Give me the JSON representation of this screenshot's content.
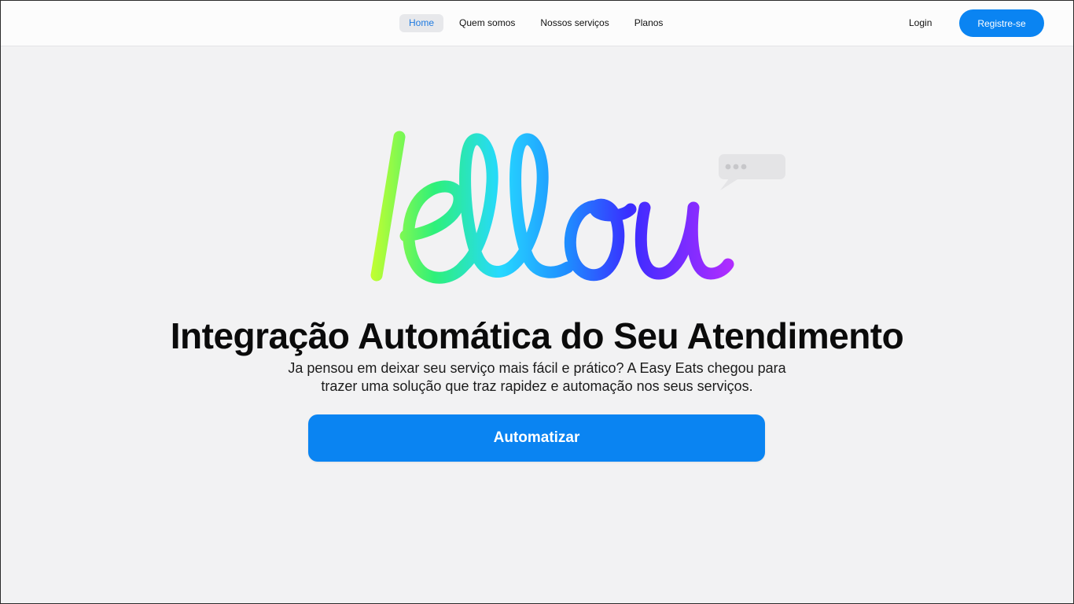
{
  "nav": {
    "items": [
      {
        "label": "Home",
        "active": true
      },
      {
        "label": "Quem somos",
        "active": false
      },
      {
        "label": "Nossos serviços",
        "active": false
      },
      {
        "label": "Planos",
        "active": false
      }
    ],
    "login_label": "Login",
    "register_label": "Registre-se"
  },
  "hero": {
    "logo_text": "lellou",
    "title": "Integração Automática do Seu Atendimento",
    "subtitle_line1": "Ja pensou em deixar seu serviço mais fácil e prático? A Easy Eats chegou para",
    "subtitle_line2": "trazer uma solução que traz rapidez e automação nos seus serviços.",
    "cta_label": "Automatizar"
  },
  "colors": {
    "accent": "#0a84f2",
    "active_nav_text": "#1f7ae0",
    "active_nav_bg": "#e7e8eb",
    "background": "#f2f2f3",
    "logo_gradient": [
      "#c6ff2e",
      "#2ef07a",
      "#26d9ff",
      "#1f8bff",
      "#3a2cff",
      "#b02cff"
    ]
  },
  "icons": {
    "chat_bubble": "chat-bubble-typing-icon"
  }
}
